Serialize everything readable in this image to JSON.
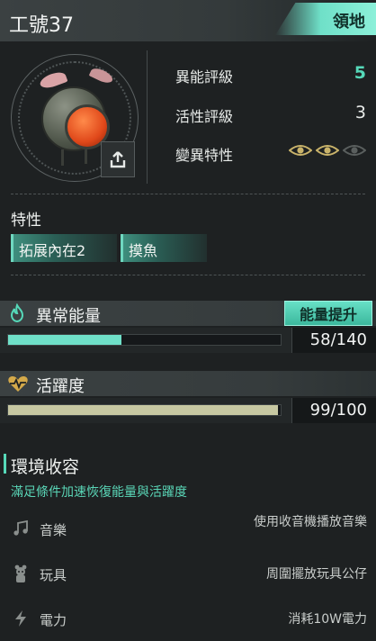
{
  "header": {
    "title": "工號37",
    "badge": "領地"
  },
  "ratings": [
    {
      "label": "異能評級",
      "value": "5"
    },
    {
      "label": "活性評級",
      "value": "3"
    },
    {
      "label": "變異特性"
    }
  ],
  "mutation_eyes": {
    "active": 2,
    "total": 3
  },
  "traits": {
    "title": "特性",
    "items": [
      "拓展內在2",
      "摸魚"
    ]
  },
  "energy": {
    "label": "異常能量",
    "value_text": "58/140",
    "current": 58,
    "max": 140,
    "boost_label": "能量提升",
    "color": "#6fe0c8"
  },
  "activity": {
    "label": "活躍度",
    "value_text": "99/100",
    "current": 99,
    "max": 100,
    "color": "#c7c8a2"
  },
  "environment": {
    "title": "環境收容",
    "subtitle": "滿足條件加速恢復能量與活躍度",
    "items": [
      {
        "name": "音樂",
        "icon": "music-note-icon",
        "desc": "使用收音機播放音樂"
      },
      {
        "name": "玩具",
        "icon": "toy-icon",
        "desc": "周圍擺放玩具公仔"
      },
      {
        "name": "電力",
        "icon": "lightning-icon",
        "desc": "消耗10W電力"
      }
    ]
  },
  "colors": {
    "accent": "#56d9b9",
    "background": "#1e2122"
  }
}
